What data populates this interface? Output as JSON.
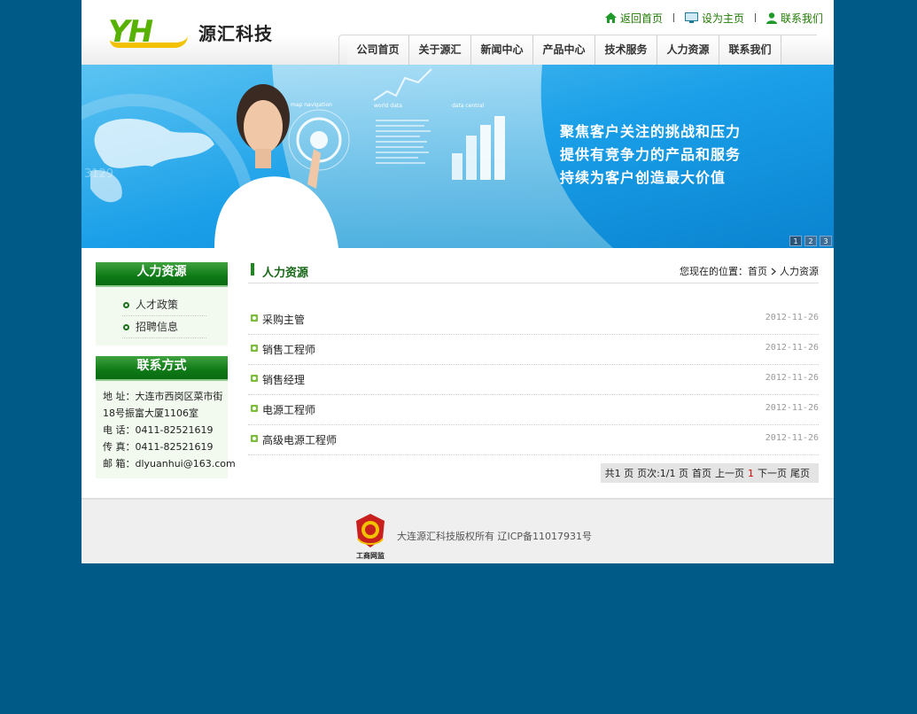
{
  "logo": {
    "letters": "YH",
    "name": "源汇科技"
  },
  "toplinks": [
    {
      "label": "返回首页",
      "icon": "home-icon"
    },
    {
      "label": "设为主页",
      "icon": "monitor-icon"
    },
    {
      "label": "联系我们",
      "icon": "user-icon"
    }
  ],
  "nav": [
    "公司首页",
    "关于源汇",
    "新闻中心",
    "产品中心",
    "技术服务",
    "人力资源",
    "联系我们"
  ],
  "banner": {
    "slogans": [
      "聚焦客户关注的挑战和压力",
      "提供有竞争力的产品和服务",
      "持续为客户创造最大价值"
    ],
    "labels": {
      "map": "map navigation",
      "world": "world data",
      "central": "data central",
      "counter": "3129"
    },
    "dots": [
      "1",
      "2",
      "3"
    ]
  },
  "sidebar": {
    "hr_title": "人力资源",
    "links": [
      "人才政策",
      "招聘信息"
    ],
    "contact_title": "联系方式",
    "contact_lines": [
      "地 址：大连市西岗区菜市街",
      "18号振富大厦1106室",
      "电 话：0411-82521619",
      "传 真：0411-82521619",
      "邮 箱：dlyuanhui@163.com"
    ]
  },
  "main": {
    "title": "人力资源",
    "breadcrumb": {
      "prefix": "您现在的位置：",
      "home": "首页",
      "current": "人力资源"
    },
    "rows": [
      {
        "title": "采购主管",
        "date": "2012-11-26"
      },
      {
        "title": "销售工程师",
        "date": "2012-11-26"
      },
      {
        "title": "销售经理",
        "date": "2012-11-26"
      },
      {
        "title": "电源工程师",
        "date": "2012-11-26"
      },
      {
        "title": "高级电源工程师",
        "date": "2012-11-26"
      }
    ],
    "pager": {
      "total": "共1 页",
      "pages": "页次:1/1 页",
      "first": "首页",
      "prev": "上一页",
      "current": "1",
      "next": "下一页",
      "last": "尾页"
    }
  },
  "footer": {
    "badge": "工商网监",
    "copyright": "大连源汇科技版权所有  辽ICP备11017931号"
  },
  "colors": {
    "background": "#005a88",
    "accent_green": "#1e8a1e",
    "banner_blue": "#1a9fe8"
  }
}
